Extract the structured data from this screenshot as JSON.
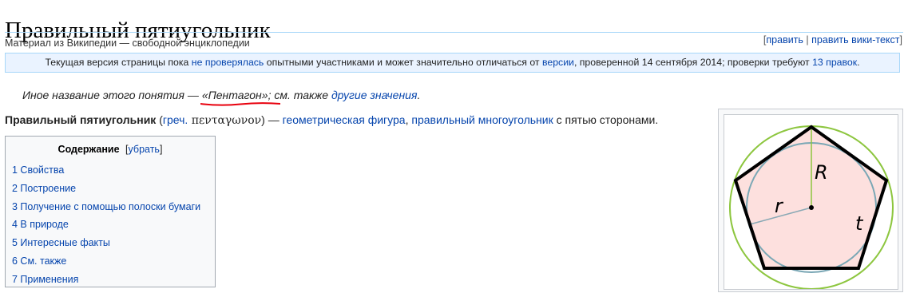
{
  "title": "Правильный пятиугольник",
  "tagline": "Материал из Википедии — свободной энциклопедии",
  "edit_links": {
    "open": "[",
    "edit": "править",
    "sep": " | ",
    "edit_source": "править вики-текст",
    "close": "]"
  },
  "flagged": {
    "t1": "Текущая версия страницы пока ",
    "link1": "не проверялась",
    "t2": " опытными участниками и может значительно отличаться от ",
    "link2": "версии",
    "t3": ", проверенной 14 сентября 2014; проверки требуют ",
    "link3": "13 правок",
    "t4": "."
  },
  "hatnote": {
    "t1": "Иное название этого понятия — ",
    "quoted": "«Пентагон»",
    "t2": "; см. также ",
    "link": "другие значения",
    "t3": "."
  },
  "lead": {
    "bold": "Правильный пятиугольник",
    "t1": " (",
    "link_lang": "греч.",
    "greek": " πενταγωνον",
    "t2": ") — ",
    "link_fig": "геометрическая фигура",
    "t3": ", ",
    "link_poly": "правильный многоугольник",
    "t4": " с пятью сторонами."
  },
  "toc": {
    "title": "Содержание",
    "toggle_open": "[",
    "toggle": "убрать",
    "toggle_close": "]",
    "items": [
      {
        "label": "1 Свойства"
      },
      {
        "label": "2 Построение"
      },
      {
        "label": "3 Получение с помощью полоски бумаги"
      },
      {
        "label": "4 В природе"
      },
      {
        "label": "5 Интересные факты"
      },
      {
        "label": "6 См. также"
      },
      {
        "label": "7 Применения"
      }
    ]
  },
  "figure": {
    "label_R": "R",
    "label_r": "r",
    "label_t": "t",
    "colors": {
      "outer_circle": "#8dc63f",
      "inner_circle": "#7aa7b5",
      "fill": "#fde0de",
      "polygon_stroke": "#000000",
      "radius_R": "#8dc63f",
      "radius_r": "#8aa9b5"
    }
  },
  "colors": {
    "link": "#0645ad",
    "squiggle": "#e8000d",
    "flagged_bg": "#eaf3ff",
    "flagged_border": "#a7d7f9"
  }
}
